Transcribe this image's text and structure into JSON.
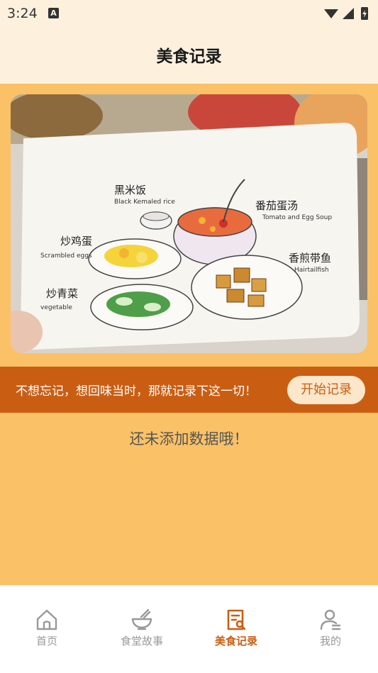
{
  "status_bar": {
    "time": "3:24",
    "notif_icon": "A"
  },
  "header": {
    "title": "美食记录"
  },
  "hero": {
    "dishes": [
      {
        "cn": "黑米饭",
        "en": "Black Kemaled rice"
      },
      {
        "cn": "番茄蛋汤",
        "en": "Tomato and Egg Soup"
      },
      {
        "cn": "炒鸡蛋",
        "en": "Scrambled eggs"
      },
      {
        "cn": "香煎带鱼",
        "en": "Hairtailfish"
      },
      {
        "cn": "炒青菜",
        "en": "vegetable"
      }
    ]
  },
  "banner": {
    "text": "不想忘记，想回味当时，那就记录下这一切！",
    "button_label": "开始记录"
  },
  "empty_state": {
    "text": "还未添加数据哦！"
  },
  "bottom_nav": {
    "tabs": [
      {
        "label": "首页",
        "icon": "home-icon",
        "active": false
      },
      {
        "label": "食堂故事",
        "icon": "bowl-icon",
        "active": false
      },
      {
        "label": "美食记录",
        "icon": "note-search-icon",
        "active": true
      },
      {
        "label": "我的",
        "icon": "user-icon",
        "active": false
      }
    ]
  },
  "colors": {
    "accent": "#C95E13",
    "background": "#FAC166",
    "header_bg": "#FDF1DE",
    "inactive": "#999999"
  }
}
